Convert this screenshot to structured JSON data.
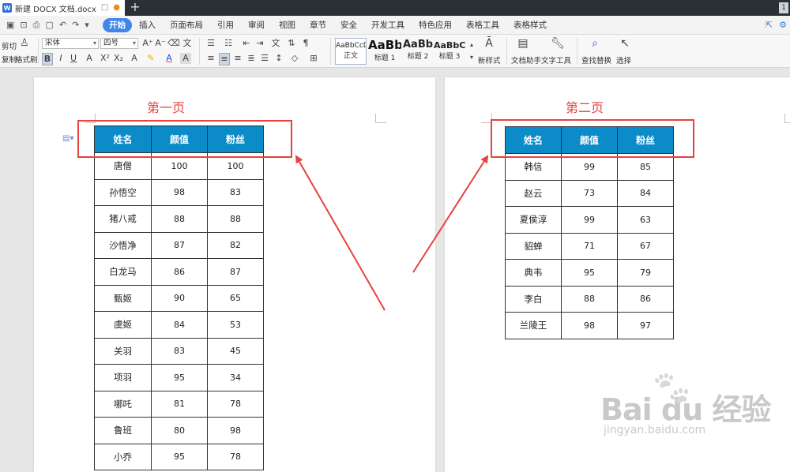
{
  "titlebar": {
    "app_icon": "W",
    "doc_title": "新建 DOCX 文档.docx",
    "new_tab": "+",
    "badge": "1"
  },
  "menubar": {
    "quick_icons": [
      "save-icon",
      "print-icon",
      "undo-icon",
      "redo-icon"
    ],
    "tabs": [
      "开始",
      "插入",
      "页面布局",
      "引用",
      "审阅",
      "视图",
      "章节",
      "安全",
      "开发工具",
      "特色应用",
      "表格工具",
      "表格样式"
    ],
    "active_tab": "开始"
  },
  "toolbar": {
    "clipboard": {
      "cut": "剪切",
      "copy": "复制",
      "format_painter": "格式刷"
    },
    "font_name": "宋体",
    "font_size": "四号",
    "styles": [
      {
        "sample": "AaBbCcDd",
        "label": "正文"
      },
      {
        "sample": "AaBb",
        "label": "标题 1"
      },
      {
        "sample": "AaBb(",
        "label": "标题 2"
      },
      {
        "sample": "AaBbC",
        "label": "标题 3"
      }
    ],
    "new_style": "新样式",
    "doc_helper": "文档助手",
    "text_tools": "文字工具",
    "find_replace": "查找替换",
    "select": "选择"
  },
  "page1": {
    "title": "第一页",
    "headers": [
      "姓名",
      "颜值",
      "粉丝"
    ],
    "rows": [
      [
        "唐僧",
        "100",
        "100"
      ],
      [
        "孙悟空",
        "98",
        "83"
      ],
      [
        "猪八戒",
        "88",
        "88"
      ],
      [
        "沙悟净",
        "87",
        "82"
      ],
      [
        "白龙马",
        "86",
        "87"
      ],
      [
        "甄姬",
        "90",
        "65"
      ],
      [
        "虞姬",
        "84",
        "53"
      ],
      [
        "关羽",
        "83",
        "45"
      ],
      [
        "项羽",
        "95",
        "34"
      ],
      [
        "哪吒",
        "81",
        "78"
      ],
      [
        "鲁班",
        "80",
        "98"
      ],
      [
        "小乔",
        "95",
        "78"
      ]
    ]
  },
  "page2": {
    "title": "第二页",
    "headers": [
      "姓名",
      "颜值",
      "粉丝"
    ],
    "rows": [
      [
        "韩信",
        "99",
        "85"
      ],
      [
        "赵云",
        "73",
        "84"
      ],
      [
        "夏侯淳",
        "99",
        "63"
      ],
      [
        "貂蝉",
        "71",
        "67"
      ],
      [
        "典韦",
        "95",
        "79"
      ],
      [
        "李白",
        "88",
        "86"
      ],
      [
        "兰陵王",
        "98",
        "97"
      ]
    ]
  },
  "watermark": {
    "brand": "Bai du 经验",
    "url": "jingyan.baidu.com"
  },
  "colors": {
    "header_bg": "#0b8cc8",
    "highlight": "#e8413e",
    "active_tab": "#3f87e8"
  }
}
